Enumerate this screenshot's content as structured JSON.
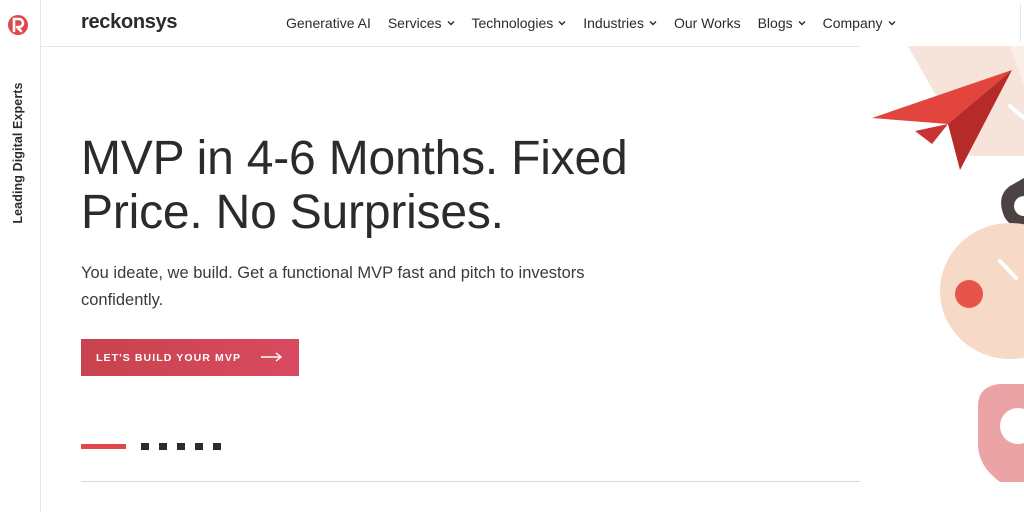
{
  "rail": {
    "tagline": "Leading Digital Experts"
  },
  "header": {
    "brand": "reckonsys",
    "nav": [
      {
        "label": "Generative AI",
        "has_dropdown": false
      },
      {
        "label": "Services",
        "has_dropdown": true
      },
      {
        "label": "Technologies",
        "has_dropdown": true
      },
      {
        "label": "Industries",
        "has_dropdown": true
      },
      {
        "label": "Our Works",
        "has_dropdown": false
      },
      {
        "label": "Blogs",
        "has_dropdown": true
      },
      {
        "label": "Company",
        "has_dropdown": true
      }
    ]
  },
  "hero": {
    "title": "MVP in 4-6 Months. Fixed Price. No Surprises.",
    "subtitle": "You ideate, we build. Get a functional MVP fast and pitch to investors confidently.",
    "cta_label": "LET'S BUILD YOUR MVP",
    "slides": {
      "active": 1,
      "total": 6
    }
  },
  "colors": {
    "accent": "#e0464a",
    "cta_start": "#c8434d",
    "cta_end": "#d84a60",
    "text": "#2b2b2b"
  },
  "icons": {
    "logo": "reckonsys-logo-icon",
    "chevron": "chevron-down-icon",
    "arrow": "arrow-right-icon",
    "plane": "paper-plane-icon"
  }
}
